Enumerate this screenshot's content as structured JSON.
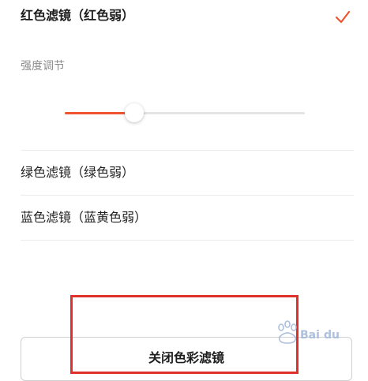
{
  "filters": {
    "red": {
      "label": "红色滤镜（红色弱）",
      "selected": true
    },
    "green": {
      "label": "绿色滤镜（绿色弱）",
      "selected": false
    },
    "blue": {
      "label": "蓝色滤镜（蓝黄色弱）",
      "selected": false
    }
  },
  "strength": {
    "label": "强度调节",
    "value_fraction": 0.29
  },
  "close_button": {
    "label": "关闭色彩滤镜"
  },
  "watermark": {
    "text": "Bai du 经验"
  },
  "colors": {
    "accent": "#f0532f",
    "annotation": "#e0302c"
  },
  "icons": {
    "selected_mark": "check-icon"
  }
}
